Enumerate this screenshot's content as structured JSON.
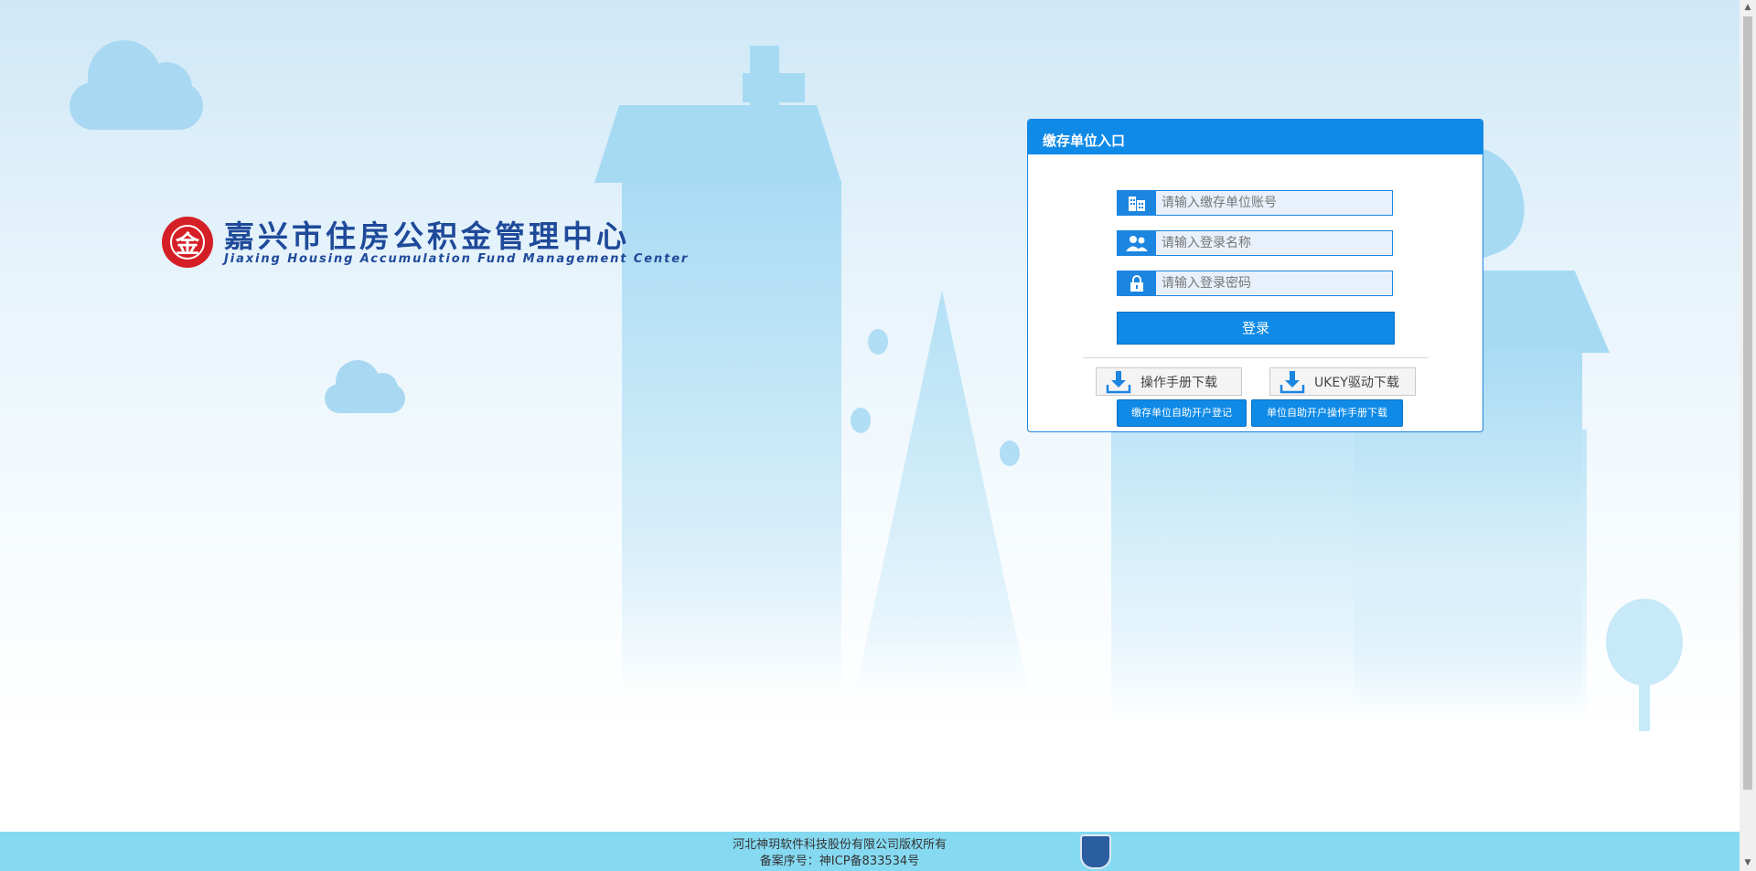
{
  "logo": {
    "seal_glyph": "金",
    "name_cn": "嘉兴市住房公积金管理中心",
    "name_en": "Jiaxing Housing Accumulation Fund Management Center"
  },
  "login": {
    "title": "缴存单位入口",
    "account_placeholder": "请输入缴存单位账号",
    "username_placeholder": "请输入登录名称",
    "password_placeholder": "请输入登录密码",
    "login_label": "登录",
    "manual_download_label": "操作手册下载",
    "ukey_download_label": "UKEY驱动下载",
    "self_register_label": "缴存单位自助开户登记",
    "self_manual_label": "单位自助开户操作手册下载"
  },
  "footer": {
    "copyright": "河北神玥软件科技股份有限公司版权所有",
    "icp": "备案序号：神ICP备833534号"
  },
  "colors": {
    "primary": "#0f8ae6",
    "brand_text": "#1f4a9a",
    "seal_red": "#d51f26",
    "footer_bg": "#85daf2"
  }
}
